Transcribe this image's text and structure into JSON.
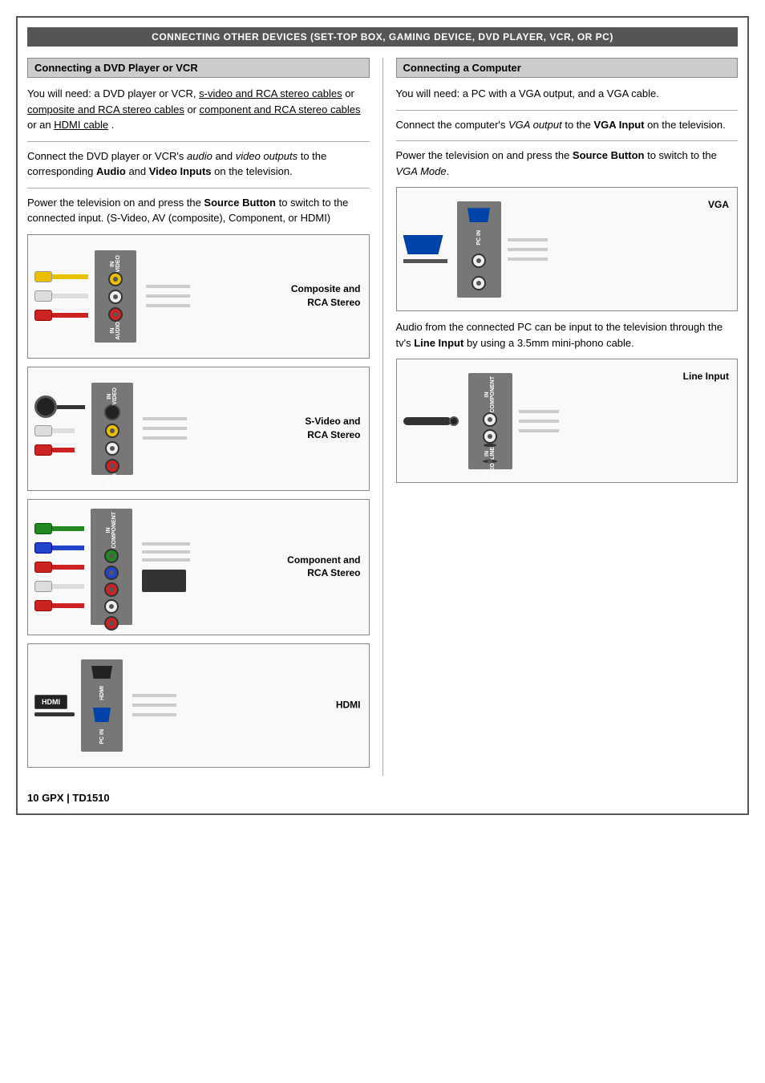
{
  "page": {
    "title": "CONNECTING OTHER DEVICES (SET-TOP BOX, GAMING DEVICE, DVD PLAYER, VCR, OR PC)",
    "footer": "10    GPX  |  TD1510"
  },
  "left": {
    "section_title": "Connecting a DVD Player or VCR",
    "para1": "You will need: a DVD player or VCR, s-video and RCA stereo cables or composite and RCA stereo cables or component and RCA stereo cables or an HDMI cable.",
    "para2": "Connect the DVD player or VCR's audio and video outputs to the corresponding Audio and Video Inputs on the television.",
    "para3": "Power the television on and press the Source Button to switch to the connected input. (S-Video, AV (composite), Component, or HDMI)",
    "diagrams": [
      {
        "label": "Composite and\nRCA Stereo",
        "type": "composite"
      },
      {
        "label": "S-Video and\nRCA Stereo",
        "type": "svideo"
      },
      {
        "label": "Component and\nRCA Stereo",
        "type": "component"
      },
      {
        "label": "HDMI",
        "type": "hdmi"
      }
    ]
  },
  "right": {
    "section_title": "Connecting a Computer",
    "para1": "You will need: a PC with a VGA output, and a VGA cable.",
    "para2_prefix": "Connect the computer's ",
    "para2_italic": "VGA output",
    "para2_suffix": " to the ",
    "para2_bold": "VGA Input",
    "para2_end": " on the television.",
    "para3_prefix": "Power the television on and press the ",
    "para3_bold": "Source Button",
    "para3_suffix": " to switch to the ",
    "para3_italic": "VGA Mode",
    "para3_end": ".",
    "diagram1_label": "VGA",
    "para4": "Audio from the connected PC can be input to the television through the tv's Line Input by using a 3.5mm mini-phono cable.",
    "diagram2_label": "Line Input"
  }
}
